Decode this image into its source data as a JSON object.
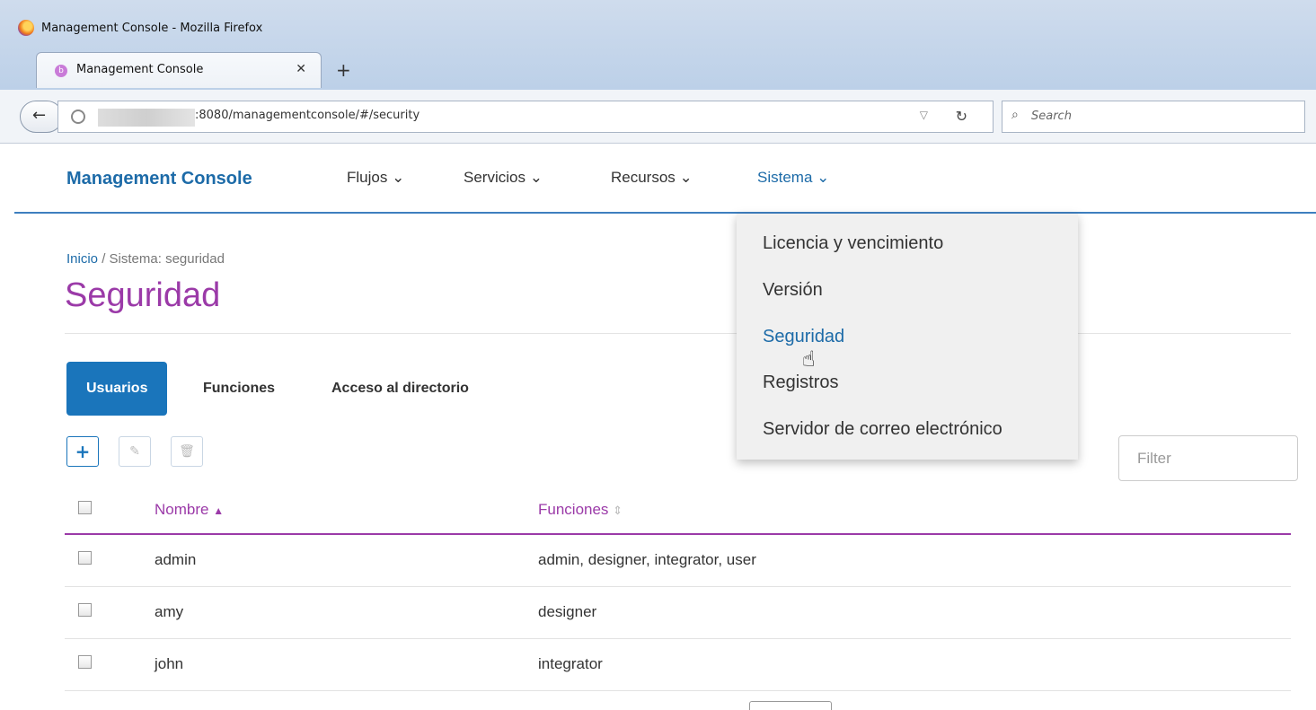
{
  "window": {
    "title": "Management Console - Mozilla Firefox"
  },
  "browser": {
    "tab_label": "Management Console",
    "url": ":8080/managementconsole/#/security",
    "search_placeholder": "Search"
  },
  "app": {
    "brand": "Management Console",
    "menu": [
      {
        "label": "Flujos",
        "chevron": "⌄"
      },
      {
        "label": "Servicios",
        "chevron": "⌄"
      },
      {
        "label": "Recursos",
        "chevron": "⌄"
      },
      {
        "label": "Sistema",
        "chevron": "⌄"
      }
    ]
  },
  "breadcrumb": {
    "home": "Inicio",
    "sep": "/",
    "current": "Sistema: seguridad"
  },
  "page_title": "Seguridad",
  "tabs": [
    "Usuarios",
    "Funciones",
    "Acceso al directorio"
  ],
  "toolbar": {
    "add": "+",
    "edit": "✎",
    "delete": "🗑"
  },
  "filter_placeholder": "Filter",
  "table": {
    "headers": [
      "Nombre",
      "Funciones"
    ],
    "header_sort": [
      "▲",
      "⇕"
    ],
    "rows": [
      {
        "name": "admin",
        "roles": "admin, designer, integrator, user"
      },
      {
        "name": "amy",
        "roles": "designer"
      },
      {
        "name": "john",
        "roles": "integrator"
      }
    ]
  },
  "system_menu": {
    "items": [
      "Licencia y vencimiento",
      "Versión",
      "Seguridad",
      "Registros",
      "Servidor de correo electrónico"
    ],
    "active": "Seguridad"
  },
  "colors": {
    "accent": "#1a75bb",
    "title": "#9b3aa8"
  }
}
